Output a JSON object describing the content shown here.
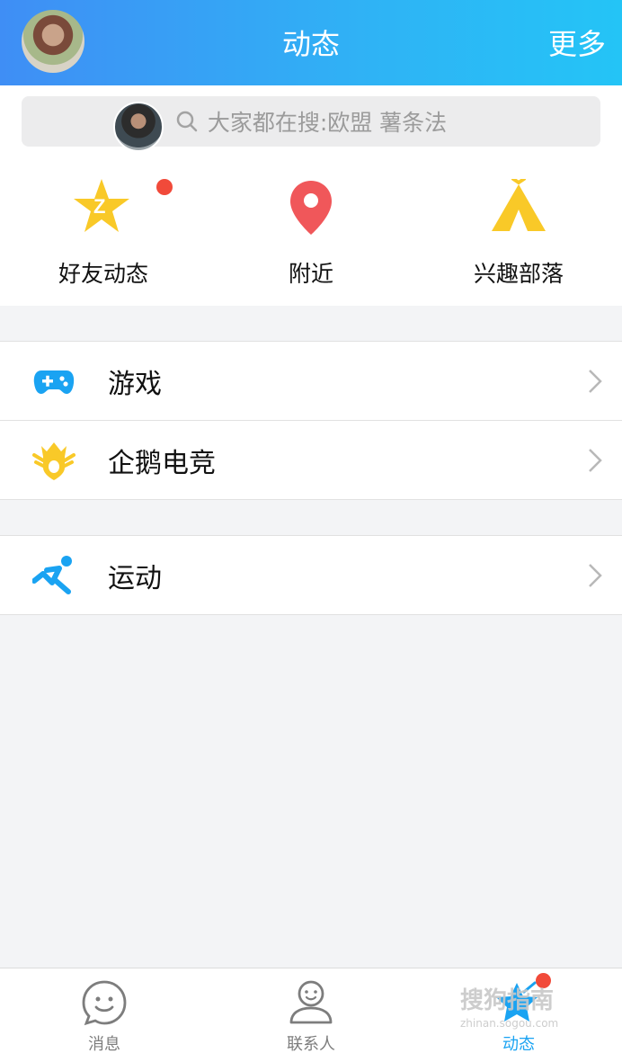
{
  "header": {
    "title": "动态",
    "more": "更多"
  },
  "search": {
    "placeholder": "大家都在搜:欧盟 薯条法"
  },
  "shortcuts": [
    {
      "label": "好友动态",
      "icon": "qzone-star-icon"
    },
    {
      "label": "附近",
      "icon": "location-pin-icon"
    },
    {
      "label": "兴趣部落",
      "icon": "tent-icon"
    }
  ],
  "groups": [
    [
      {
        "label": "游戏",
        "icon": "gamepad-icon"
      },
      {
        "label": "企鹅电竞",
        "icon": "esports-crown-icon"
      }
    ],
    [
      {
        "label": "运动",
        "icon": "running-icon"
      }
    ]
  ],
  "tabbar": [
    {
      "label": "消息",
      "icon": "chat-smile-icon",
      "active": false
    },
    {
      "label": "联系人",
      "icon": "contacts-person-icon",
      "active": false
    },
    {
      "label": "动态",
      "icon": "star-icon",
      "active": true
    }
  ],
  "watermark": {
    "main": "搜狗指南",
    "sub": "zhinan.sogou.com"
  },
  "colors": {
    "header_gradient_start": "#3f8ef5",
    "header_gradient_end": "#24c4f6",
    "accent_blue": "#1aa3f2",
    "badge_red": "#f14a3a",
    "yellow": "#f9c928",
    "pin_red": "#f0575a"
  }
}
